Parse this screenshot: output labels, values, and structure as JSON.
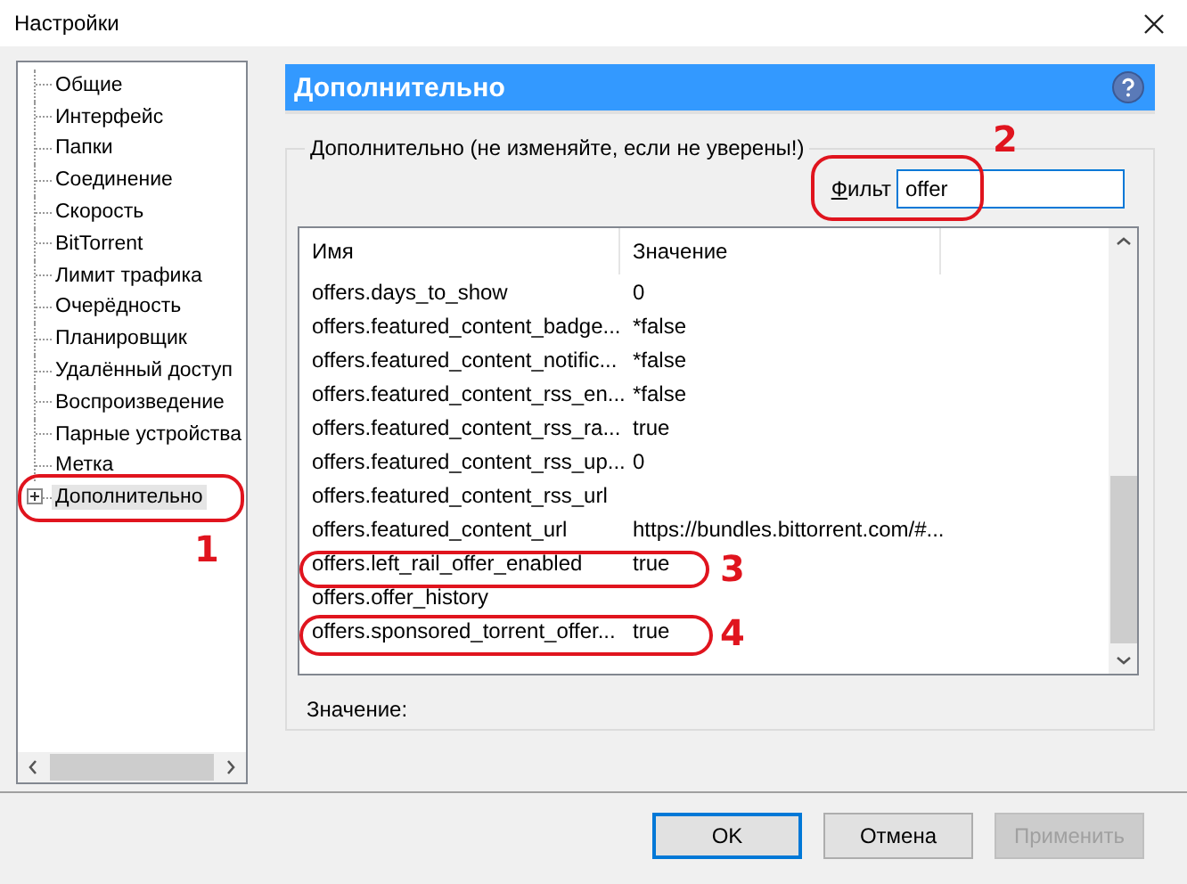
{
  "window": {
    "title": "Настройки"
  },
  "sidebar": {
    "items": [
      {
        "label": "Общие",
        "selected": false,
        "expandable": false
      },
      {
        "label": "Интерфейс",
        "selected": false,
        "expandable": false
      },
      {
        "label": "Папки",
        "selected": false,
        "expandable": false
      },
      {
        "label": "Соединение",
        "selected": false,
        "expandable": false
      },
      {
        "label": "Скорость",
        "selected": false,
        "expandable": false
      },
      {
        "label": "BitTorrent",
        "selected": false,
        "expandable": false
      },
      {
        "label": "Лимит трафика",
        "selected": false,
        "expandable": false
      },
      {
        "label": "Очерёдность",
        "selected": false,
        "expandable": false
      },
      {
        "label": "Планировщик",
        "selected": false,
        "expandable": false
      },
      {
        "label": "Удалённый доступ",
        "selected": false,
        "expandable": false
      },
      {
        "label": "Воспроизведение",
        "selected": false,
        "expandable": false
      },
      {
        "label": "Парные устройства",
        "selected": false,
        "expandable": false
      },
      {
        "label": "Метка",
        "selected": false,
        "expandable": false
      },
      {
        "label": "Дополнительно",
        "selected": true,
        "expandable": true
      }
    ]
  },
  "panel": {
    "title": "Дополнительно",
    "group_label": "Дополнительно (не изменяйте, если не уверены!)",
    "filter": {
      "label": "Фильт",
      "value": "offer"
    },
    "table": {
      "columns": [
        "Имя",
        "Значение"
      ],
      "rows": [
        {
          "name": "offers.days_to_show",
          "value": "0"
        },
        {
          "name": "offers.featured_content_badge...",
          "value": "*false"
        },
        {
          "name": "offers.featured_content_notific...",
          "value": "*false"
        },
        {
          "name": "offers.featured_content_rss_en...",
          "value": "*false"
        },
        {
          "name": "offers.featured_content_rss_ra...",
          "value": "true"
        },
        {
          "name": "offers.featured_content_rss_up...",
          "value": "0"
        },
        {
          "name": "offers.featured_content_rss_url"
        },
        {
          "name": "offers.featured_content_url",
          "value": "https://bundles.bittorrent.com/#..."
        },
        {
          "name": "offers.left_rail_offer_enabled",
          "value": "true"
        },
        {
          "name": "offers.offer_history"
        },
        {
          "name": "offers.sponsored_torrent_offer...",
          "value": "true"
        }
      ]
    },
    "value_label": "Значение:"
  },
  "buttons": [
    {
      "label": "OK",
      "default": true,
      "disabled": false
    },
    {
      "label": "Отмена",
      "default": false,
      "disabled": false
    },
    {
      "label": "Применить",
      "default": false,
      "disabled": true
    }
  ],
  "annotations": [
    {
      "label": "1"
    },
    {
      "label": "2"
    },
    {
      "label": "3"
    },
    {
      "label": "4"
    }
  ]
}
